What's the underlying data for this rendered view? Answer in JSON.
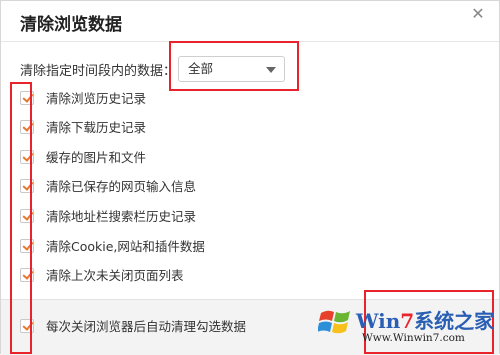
{
  "dialog": {
    "title": "清除浏览数据",
    "close_glyph": "✕"
  },
  "time_range": {
    "label": "清除指定时间段内的数据：",
    "selected": "全部"
  },
  "options": [
    {
      "label": "清除浏览历史记录",
      "checked": true
    },
    {
      "label": "清除下载历史记录",
      "checked": true
    },
    {
      "label": "缓存的图片和文件",
      "checked": true
    },
    {
      "label": "清除已保存的网页输入信息",
      "checked": true
    },
    {
      "label": "清除地址栏搜索栏历史记录",
      "checked": true
    },
    {
      "label": "清除Cookie,网站和插件数据",
      "checked": true
    },
    {
      "label": "清除上次未关闭页面列表",
      "checked": true
    }
  ],
  "footer": {
    "auto_clear_label": "每次关闭浏览器后自动清理勾选数据",
    "auto_clear_checked": true
  },
  "watermark": {
    "brand_win": "Win",
    "brand_seven": "7",
    "brand_rest": "系统之家",
    "url": "Www.Winwin7.com"
  },
  "colors": {
    "check": "#e8762d",
    "annotation": "#e8232b",
    "brand_blue": "#2a5fb3"
  }
}
